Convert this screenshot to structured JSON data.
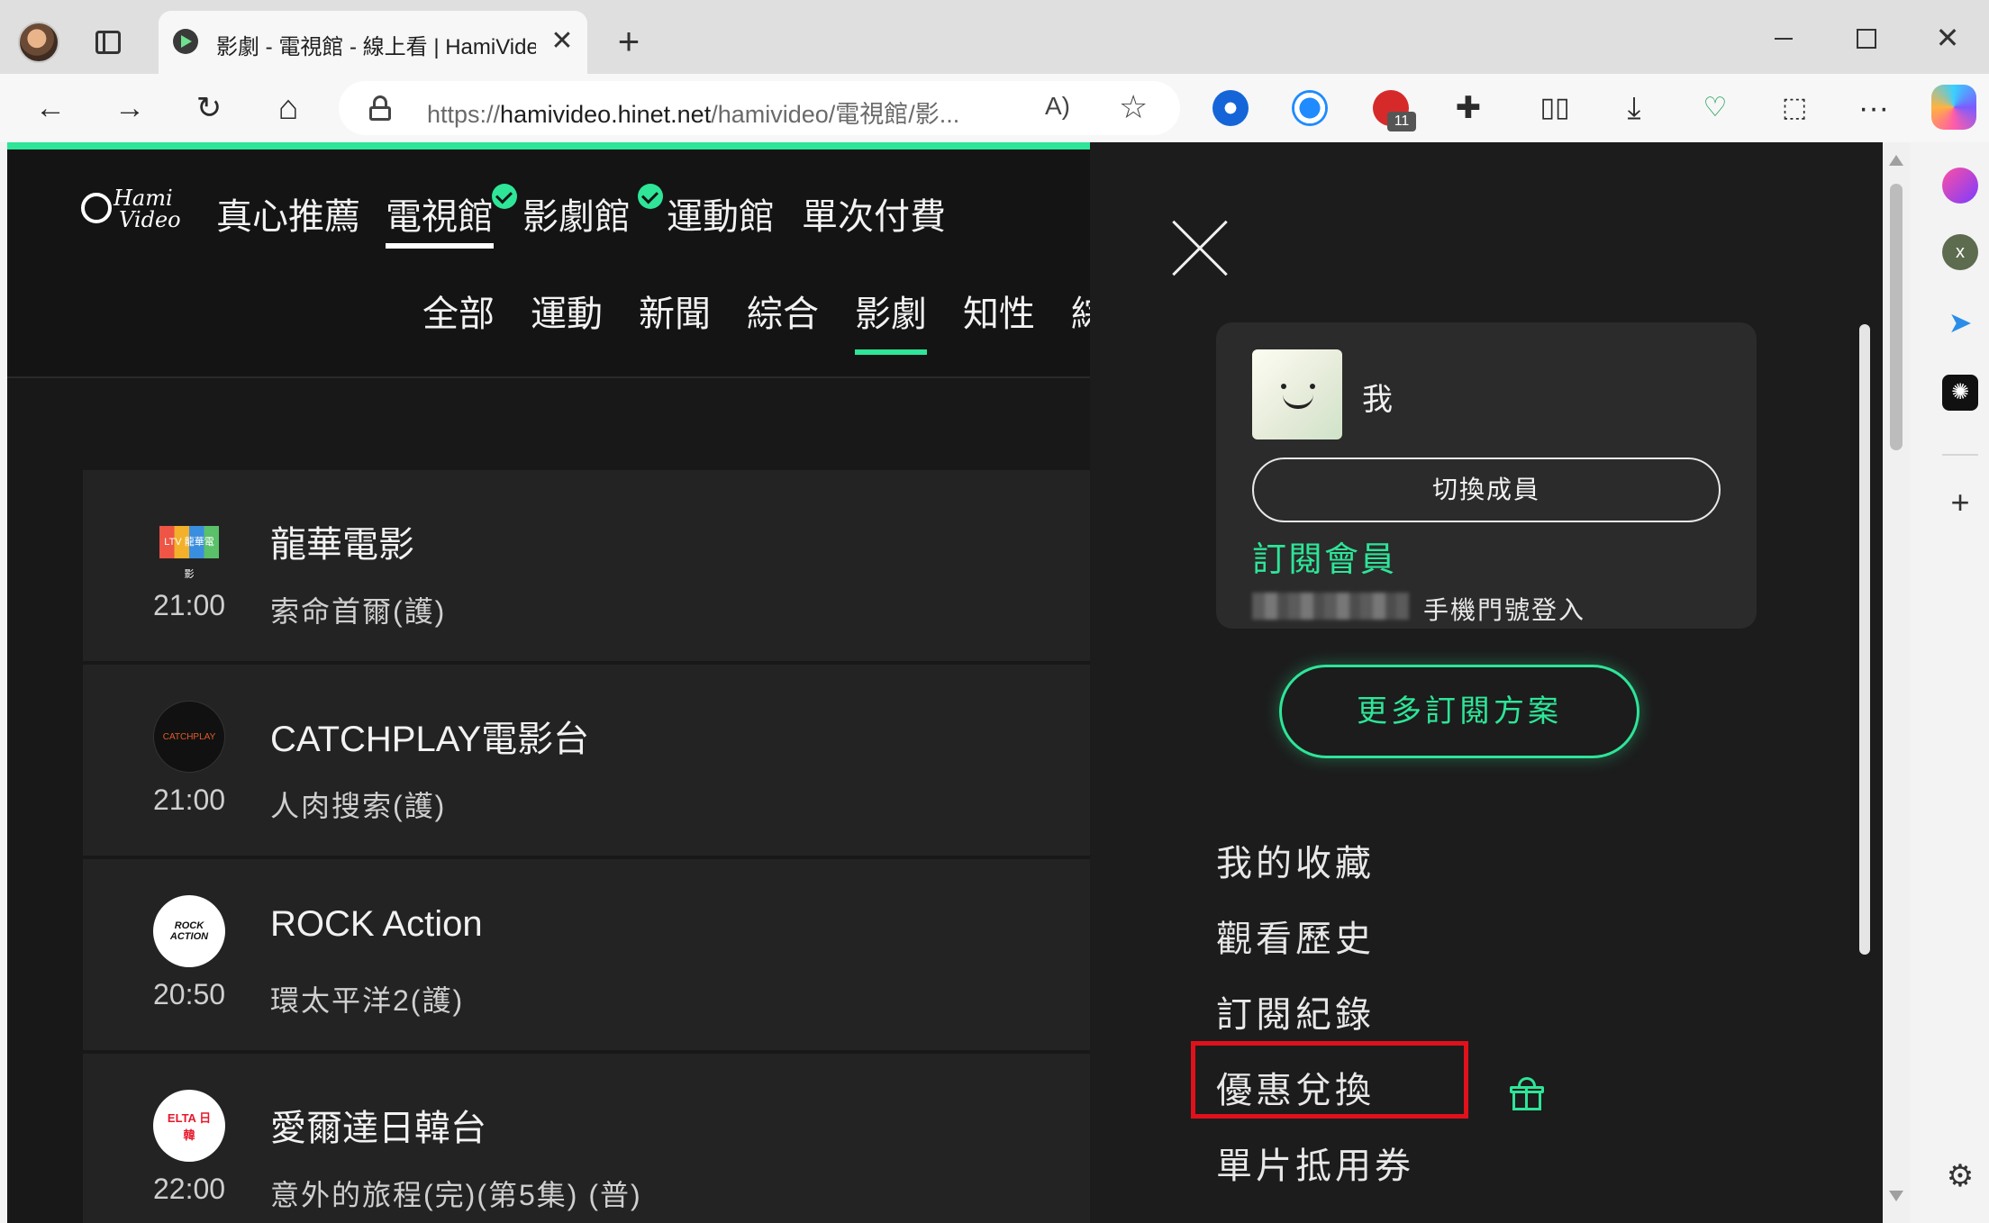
{
  "browser": {
    "tab_title": "影劇 - 電視館 - 線上看 | HamiVideo",
    "tab_close": "✕",
    "new_tab": "+",
    "url_prefix": "https://",
    "url_host": "hamivideo.hinet.net",
    "url_path": "/hamivideo/電視館/影...",
    "read_aloud": "A)",
    "favorite": "☆",
    "abp_badge": "11",
    "window_close": "✕",
    "back": "←",
    "forward": "→",
    "refresh": "↻",
    "home": "⌂",
    "downloads": "⤓",
    "more": "···",
    "sidebar_add": "+",
    "settings": "⚙"
  },
  "site": {
    "logo_line1": "Hami",
    "logo_line2": "Video",
    "nav": [
      "真心推薦",
      "電視館",
      "影劇館",
      "運動館",
      "單次付費"
    ],
    "subnav": [
      "全部",
      "運動",
      "新聞",
      "綜合",
      "影劇",
      "知性",
      "綜"
    ],
    "channels": [
      {
        "name": "龍華電影",
        "time": "21:00",
        "program": "索命首爾(護)",
        "logo": "LTV 龍華電影"
      },
      {
        "name": "CATCHPLAY電影台",
        "time": "21:00",
        "program": "人肉搜索(護)",
        "logo": "CATCHPLAY"
      },
      {
        "name": "ROCK Action",
        "time": "20:50",
        "program": "環太平洋2(護)",
        "logo": "ROCK ACTION"
      },
      {
        "name": "愛爾達日韓台",
        "time": "22:00",
        "program": "意外的旅程(完)(第5集) (普)",
        "logo": "ELTA 日韓"
      }
    ]
  },
  "drawer": {
    "profile_name": "我",
    "switch_member": "切換成員",
    "tier": "訂閱會員",
    "login_method": "手機門號登入",
    "more_plans": "更多訂閱方案",
    "menu": [
      "我的收藏",
      "觀看歷史",
      "訂閱紀錄",
      "優惠兌換",
      "單片抵用券"
    ]
  },
  "colors": {
    "accent": "#2ee598",
    "page_bg": "#181818",
    "row_bg": "#232323",
    "highlight": "#e0111b"
  }
}
